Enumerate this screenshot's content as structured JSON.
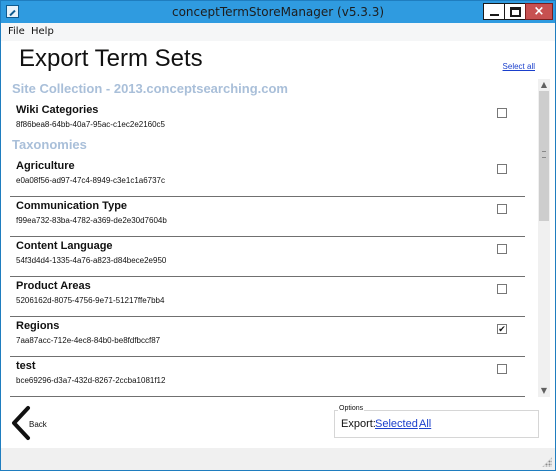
{
  "window": {
    "title": "conceptTermStoreManager (v5.3.3)",
    "close_glyph": "×",
    "accent_color": "#2f9be0"
  },
  "menu": {
    "items": [
      "File",
      "Help"
    ]
  },
  "page": {
    "title": "Export Term Sets",
    "select_all_label": "Select all"
  },
  "sections": [
    {
      "header": "Site Collection - 2013.conceptsearching.com",
      "rows": [
        {
          "name": "Wiki Categories",
          "guid": "8f86bea8-64bb-40a7-95ac-c1ec2e2160c5",
          "checked": false
        }
      ]
    },
    {
      "header": "Taxonomies",
      "rows": [
        {
          "name": "Agriculture",
          "guid": "e0a08f56-ad97-47c4-8949-c3e1c1a6737c",
          "checked": false
        },
        {
          "name": "Communication Type",
          "guid": "f99ea732-83ba-4782-a369-de2e30d7604b",
          "checked": false
        },
        {
          "name": "Content Language",
          "guid": "54f3d4d4-1335-4a76-a823-d84bece2e950",
          "checked": false
        },
        {
          "name": "Product Areas",
          "guid": "5206162d-8075-4756-9e71-51217ffe7bb4",
          "checked": false
        },
        {
          "name": "Regions",
          "guid": "7aa87acc-712e-4ec8-84b0-be8fdfbccf87",
          "checked": true
        },
        {
          "name": "test",
          "guid": "bce69296-d3a7-432d-8267-2ccba1081f12",
          "checked": false
        }
      ]
    }
  ],
  "bottom": {
    "back_label": "Back",
    "options_legend": "Options",
    "export_label": "Export:",
    "export_selected_label": "Selected",
    "export_all_label": "All",
    "check_mark": "✔"
  }
}
